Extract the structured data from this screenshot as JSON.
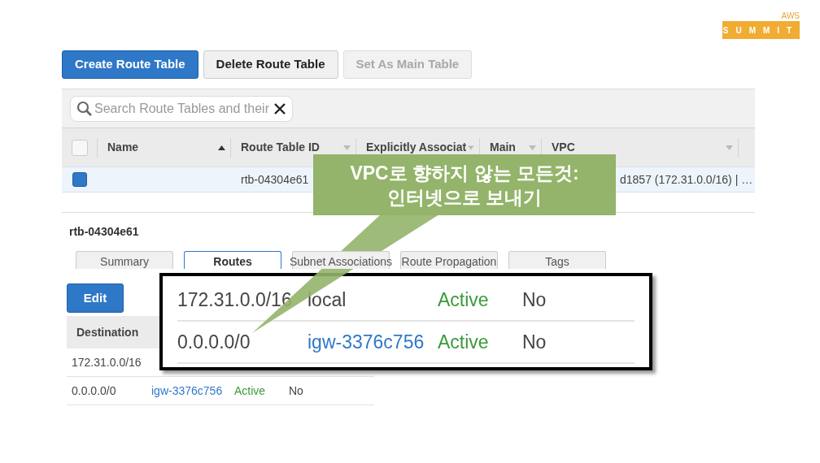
{
  "logo": {
    "small": "AWS",
    "main": "SUMMIT"
  },
  "toolbar": {
    "buttons": [
      {
        "label": "Create Route Table",
        "kind": "primary"
      },
      {
        "label": "Delete Route Table",
        "kind": "default"
      },
      {
        "label": "Set As Main Table",
        "kind": "disabled"
      }
    ]
  },
  "search": {
    "placeholder": "Search Route Tables and their"
  },
  "table": {
    "header_checked": false,
    "columns": [
      {
        "label": "Name",
        "sorted": true
      },
      {
        "label": "Route Table ID",
        "sorted": false
      },
      {
        "label": "Explicitly Associat",
        "sorted": false
      },
      {
        "label": "Main",
        "sorted": false
      },
      {
        "label": "VPC",
        "sorted": false
      }
    ],
    "rows": [
      {
        "checked": true,
        "route_table_id": "rtb-04304e61",
        "vpc": "d1857 (172.31.0.0/16) | …"
      }
    ]
  },
  "detail": {
    "title": "rtb-04304e61",
    "tabs": [
      {
        "label": "Summary",
        "selected": false
      },
      {
        "label": "Routes",
        "selected": true
      },
      {
        "label": "Subnet Associations",
        "selected": false
      },
      {
        "label": "Route Propagation",
        "selected": false
      },
      {
        "label": "Tags",
        "selected": false
      }
    ],
    "edit_button": "Edit",
    "routes": {
      "columns": [
        "Destination"
      ],
      "rows": [
        {
          "destination": "172.31.0.0/16"
        },
        {
          "destination": "0.0.0.0/0",
          "target": "igw-3376c756",
          "status": "Active",
          "propagated": "No"
        }
      ]
    }
  },
  "zoom_box": {
    "rows": [
      {
        "destination": "172.31.0.0/16",
        "target": "local",
        "target_link": false,
        "status": "Active",
        "propagated": "No"
      },
      {
        "destination": "0.0.0.0/0",
        "target": "igw-3376c756",
        "target_link": true,
        "status": "Active",
        "propagated": "No"
      }
    ]
  },
  "callout": {
    "lines": [
      "VPC로 향하지 않는 모든것:",
      "인터넷으로 보내기"
    ]
  }
}
